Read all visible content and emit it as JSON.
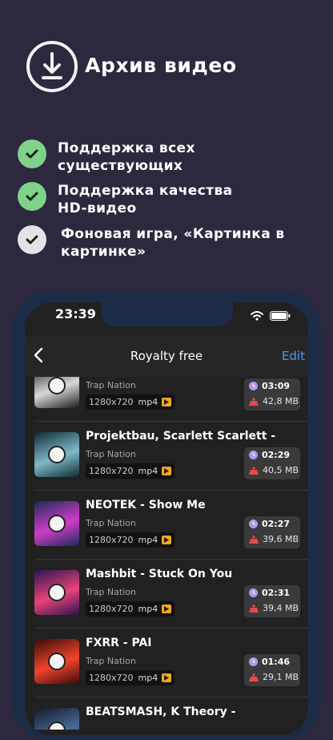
{
  "promo": {
    "title": "Архив видео",
    "features": [
      {
        "text": "Поддержка всех\nсуществующих",
        "status": "checked"
      },
      {
        "text": "Поддержка качества\nHD-видео",
        "status": "checked"
      },
      {
        "text": "Фоновая игра, «Картинка в\nкартинке»",
        "status": "unchecked"
      }
    ]
  },
  "status_bar": {
    "time": "23:39"
  },
  "nav": {
    "title": "Royalty free",
    "edit_label": "Edit"
  },
  "videos": [
    {
      "title": "",
      "channel": "Trap Nation",
      "resolution": "1280x720",
      "format": "mp4",
      "duration": "03:09",
      "size": "42,8 MB",
      "thumb_colors": [
        "#1b1b1b",
        "#d8d8d8"
      ]
    },
    {
      "title": "Projektbau, Scarlett Scarlett -",
      "channel": "Trap Nation",
      "resolution": "1280x720",
      "format": "mp4",
      "duration": "02:29",
      "size": "40,5 MB",
      "thumb_colors": [
        "#0e2b33",
        "#7fb9c8"
      ]
    },
    {
      "title": "NEOTEK - Show Me",
      "channel": "Trap Nation",
      "resolution": "1280x720",
      "format": "mp4",
      "duration": "02:27",
      "size": "39,6 MB",
      "thumb_colors": [
        "#1b2b5a",
        "#d03cc8"
      ]
    },
    {
      "title": "Mashbit - Stuck On You",
      "channel": "Trap Nation",
      "resolution": "1280x720",
      "format": "mp4",
      "duration": "02:31",
      "size": "39,4 MB",
      "thumb_colors": [
        "#2a1450",
        "#e8437a"
      ]
    },
    {
      "title": "FXRR - PAI",
      "channel": "Trap Nation",
      "resolution": "1280x720",
      "format": "mp4",
      "duration": "01:46",
      "size": "29,1 MB",
      "thumb_colors": [
        "#3b0a0a",
        "#f0442b"
      ]
    },
    {
      "title": "BEATSMASH, K Theory -",
      "channel": "",
      "resolution": "",
      "format": "",
      "duration": "",
      "size": "",
      "thumb_colors": [
        "#121a28",
        "#4a6a9a"
      ]
    }
  ],
  "colors": {
    "background": "#2e283f",
    "accent_blue": "#4f97f5",
    "check_green": "#7fd28a",
    "badge_orange": "#f3a623"
  }
}
